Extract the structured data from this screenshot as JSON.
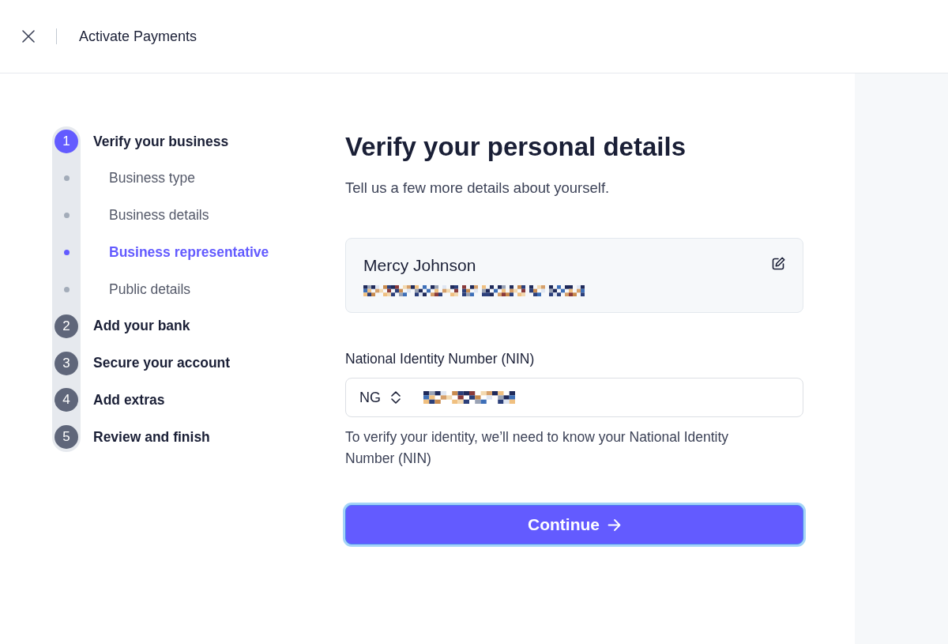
{
  "header": {
    "title": "Activate Payments"
  },
  "steps": [
    {
      "number": "1",
      "label": "Verify your business",
      "active": true,
      "children": [
        {
          "label": "Business type",
          "selected": false
        },
        {
          "label": "Business details",
          "selected": false
        },
        {
          "label": "Business representative",
          "selected": true
        },
        {
          "label": "Public details",
          "selected": false
        }
      ]
    },
    {
      "number": "2",
      "label": "Add your bank",
      "active": false
    },
    {
      "number": "3",
      "label": "Secure your account",
      "active": false
    },
    {
      "number": "4",
      "label": "Add extras",
      "active": false
    },
    {
      "number": "5",
      "label": "Review and finish",
      "active": false
    }
  ],
  "main": {
    "title": "Verify your personal details",
    "subtitle": "Tell us a few more details about yourself.",
    "person_card": {
      "name": "Mercy Johnson"
    },
    "nin_field": {
      "label": "National Identity Number (NIN)",
      "country_code": "NG"
    },
    "help_text": "To verify your identity, we’ll need to know your National Identity Number (NIN)",
    "continue_button": {
      "label": "Continue",
      "focused": true
    }
  }
}
